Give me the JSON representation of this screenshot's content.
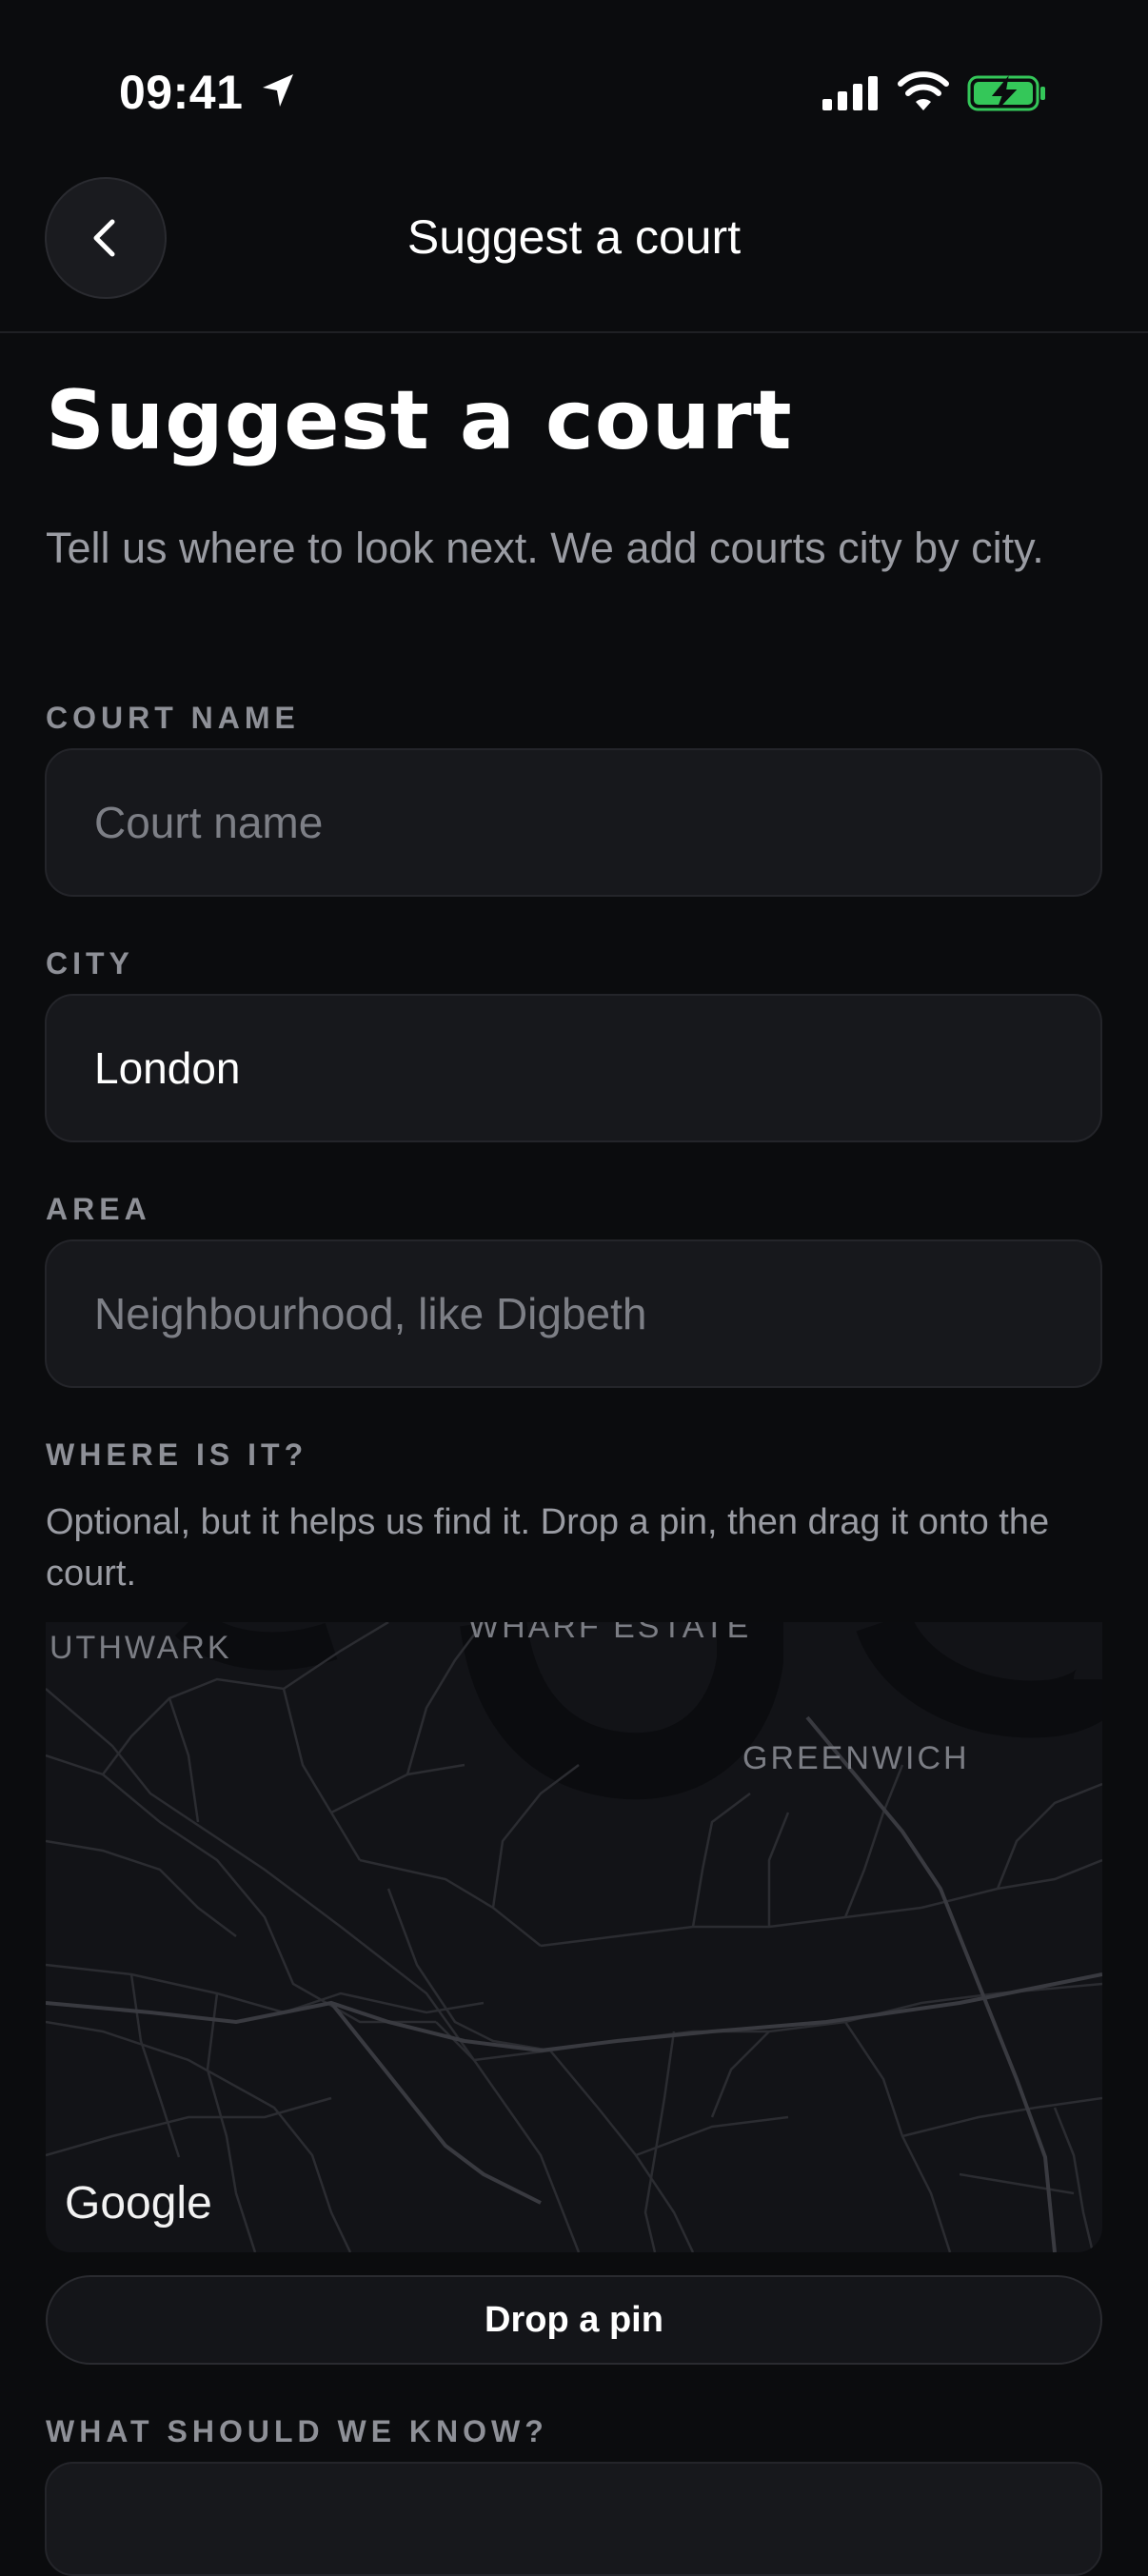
{
  "status_bar": {
    "time": "09:41"
  },
  "nav": {
    "title": "Suggest a court"
  },
  "page": {
    "title": "Suggest a court",
    "subtitle": "Tell us where to look next. We add courts city by city."
  },
  "form": {
    "court_name": {
      "label": "COURT NAME",
      "placeholder": "Court name",
      "value": ""
    },
    "city": {
      "label": "CITY",
      "placeholder": "",
      "value": "London"
    },
    "area": {
      "label": "AREA",
      "placeholder": "Neighbourhood, like Digbeth",
      "value": ""
    },
    "location": {
      "label": "WHERE IS IT?",
      "helper": "Optional, but it helps us find it. Drop a pin, then drag it onto the court.",
      "map_labels": {
        "southwark": "UTHWARK",
        "wharf_estate": "WHARF ESTATE",
        "greenwich": "GREENWICH"
      },
      "map_attribution": "Google",
      "drop_pin_label": "Drop a pin"
    },
    "notes": {
      "label": "WHAT SHOULD WE KNOW?"
    }
  },
  "colors": {
    "background": "#0b0c0e",
    "input_background": "#17181c",
    "label": "#8e9097",
    "battery_charge": "#34c759"
  }
}
